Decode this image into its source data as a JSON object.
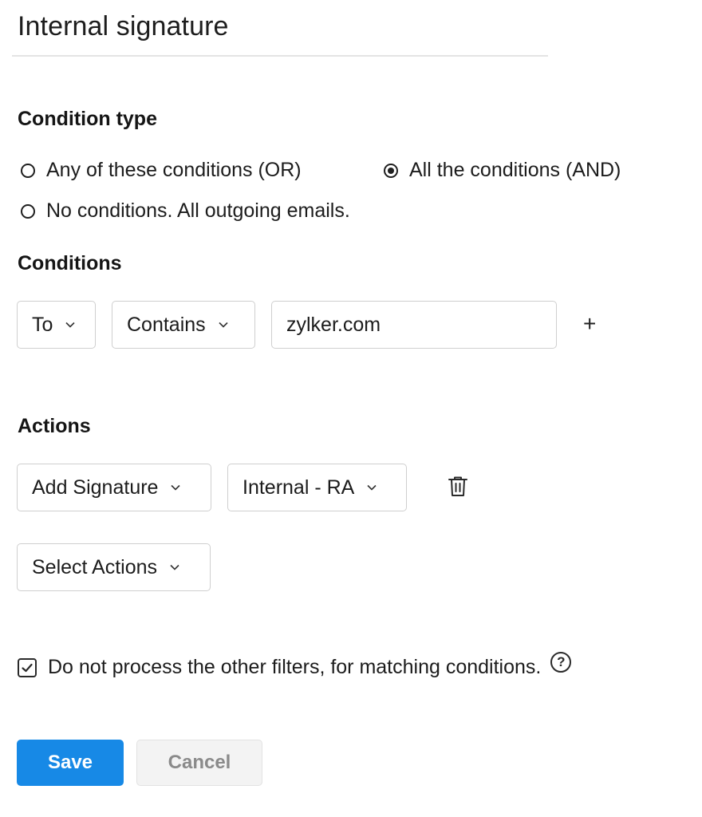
{
  "title": "Internal signature",
  "condition_type": {
    "heading": "Condition type",
    "options": [
      {
        "label": "Any of these conditions (OR)",
        "selected": false
      },
      {
        "label": "All the conditions (AND)",
        "selected": true
      },
      {
        "label": "No conditions. All outgoing emails.",
        "selected": false
      }
    ]
  },
  "conditions": {
    "heading": "Conditions",
    "field": "To",
    "operator": "Contains",
    "value": "zylker.com",
    "add_symbol": "+"
  },
  "actions": {
    "heading": "Actions",
    "action": "Add Signature",
    "signature": "Internal - RA",
    "select_placeholder": "Select Actions"
  },
  "stop_processing": {
    "label": "Do not process the other filters, for matching conditions.",
    "checked": true,
    "help_symbol": "?"
  },
  "buttons": {
    "save": "Save",
    "cancel": "Cancel"
  },
  "colors": {
    "primary": "#1789e6",
    "border": "#cfcfcf",
    "cancel_text": "#8a8a8a"
  },
  "icons": [
    "chevron-down-icon",
    "plus-icon",
    "trash-icon",
    "checkbox-checked-icon",
    "help-icon",
    "radio-icon"
  ]
}
